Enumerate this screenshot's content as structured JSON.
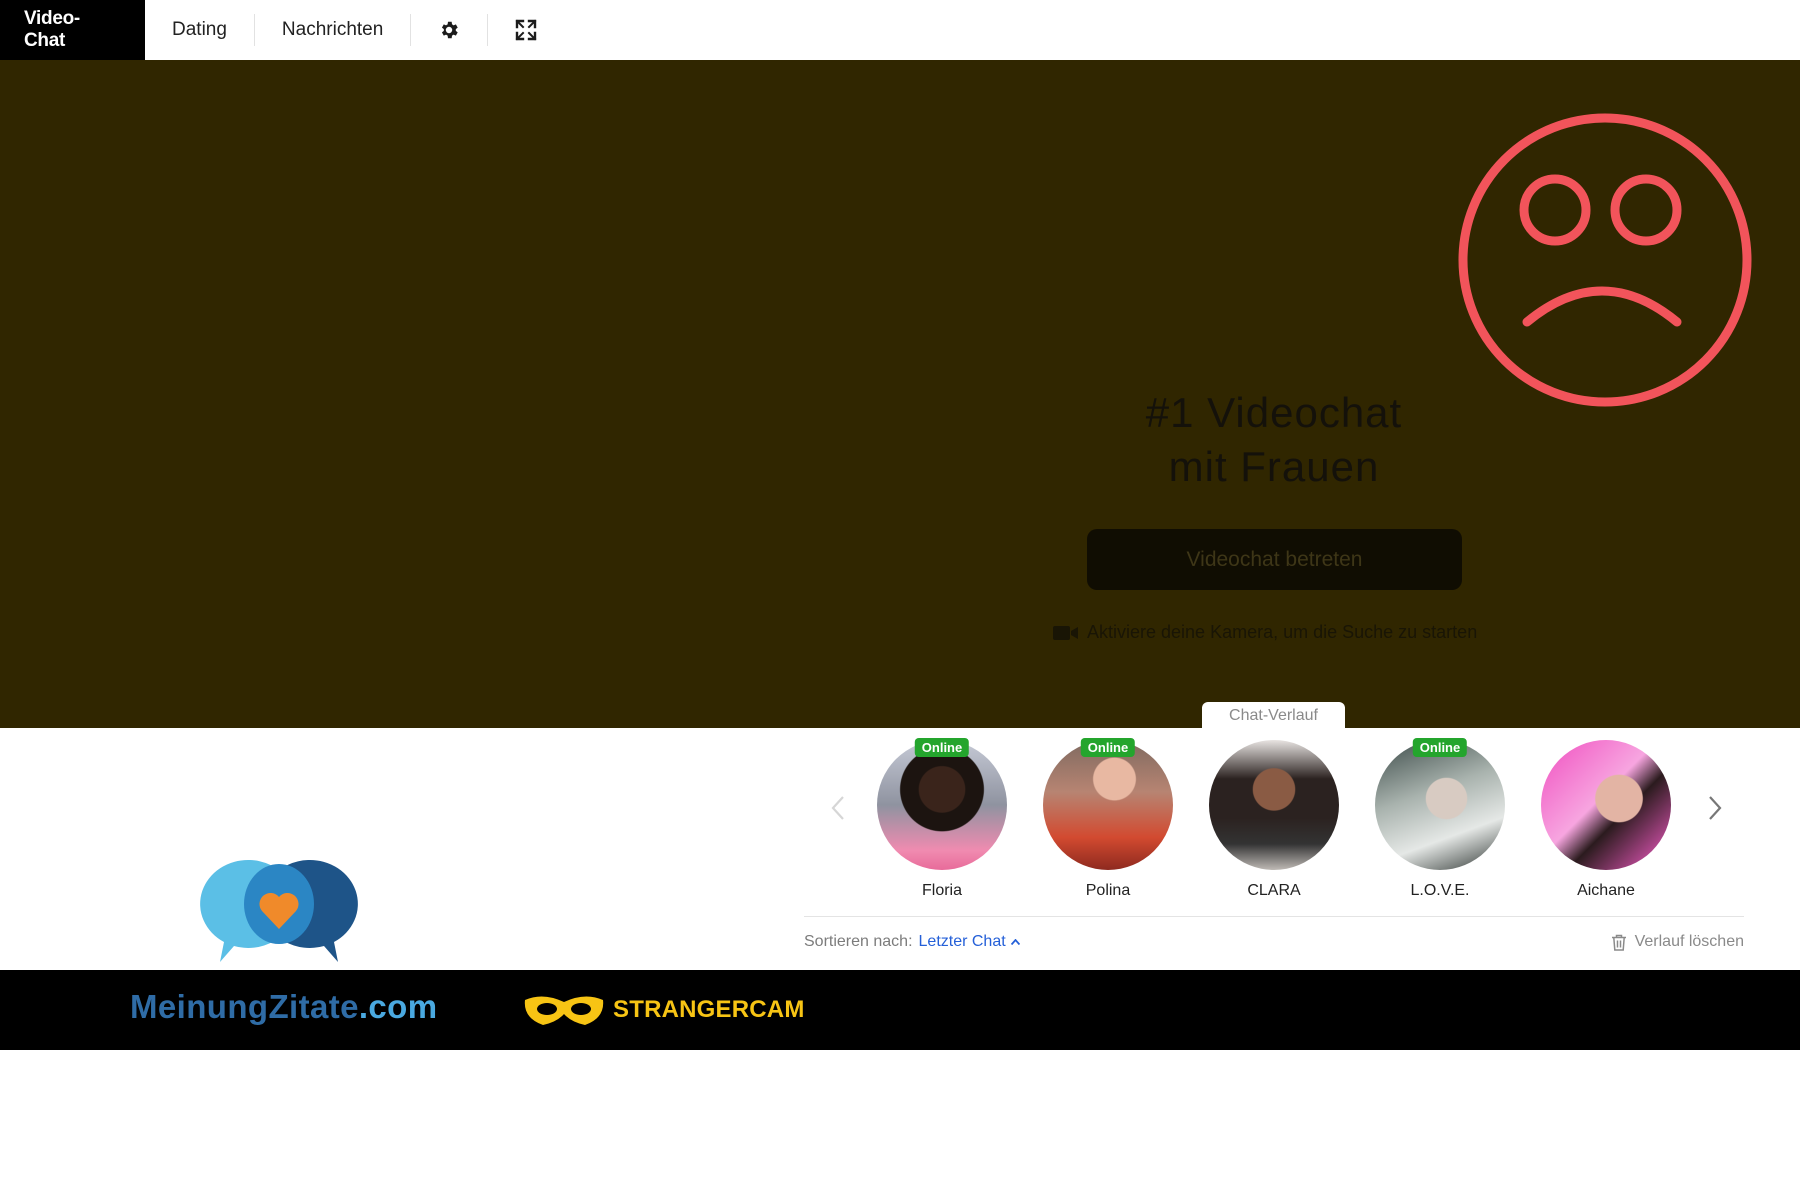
{
  "nav": {
    "tabs": [
      {
        "label": "Video-Chat",
        "active": true
      },
      {
        "label": "Dating",
        "active": false
      },
      {
        "label": "Nachrichten",
        "active": false
      }
    ],
    "icons": [
      "gear-icon",
      "fullscreen-icon"
    ]
  },
  "stage": {
    "background_color": "#302600",
    "hero_line1": "#1 Videochat",
    "hero_line2": "mit Frauen",
    "enter_button": "Videochat betreten",
    "camera_hint": "Aktiviere deine Kamera, um die Suche zu starten",
    "overlay_icon": "sad-face-icon",
    "overlay_color": "#f2545b"
  },
  "history": {
    "tab_label": "Chat-Verlauf",
    "contacts": [
      {
        "name": "Floria",
        "online": true,
        "badge": "Online"
      },
      {
        "name": "Polina",
        "online": true,
        "badge": "Online"
      },
      {
        "name": "CLARA",
        "online": false,
        "badge": ""
      },
      {
        "name": "L.O.V.E.",
        "online": true,
        "badge": "Online"
      },
      {
        "name": "Aichane",
        "online": false,
        "badge": ""
      }
    ],
    "sort_label": "Sortieren nach:",
    "sort_value": "Letzter Chat",
    "clear_label": "Verlauf löschen"
  },
  "banner": {
    "mz_brand": "MeinungZitate",
    "mz_suffix": ".com",
    "sc_brand": "STRANGERCAM"
  }
}
